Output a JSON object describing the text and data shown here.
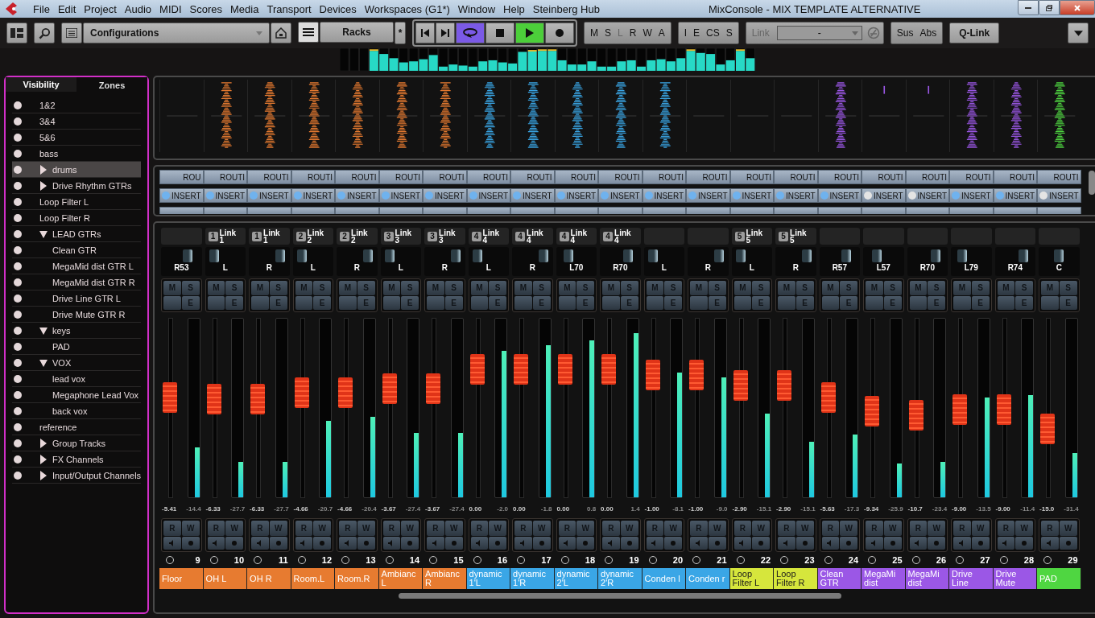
{
  "window": {
    "title": "MixConsole - MIX TEMPLATE ALTERNATIVE"
  },
  "menu": [
    "File",
    "Edit",
    "Project",
    "Audio",
    "MIDI",
    "Scores",
    "Media",
    "Transport",
    "Devices",
    "Workspaces (G1*)",
    "Window",
    "Help",
    "Steinberg Hub"
  ],
  "toolbar": {
    "configurations": "Configurations",
    "racks": "Racks",
    "racks_modified": "*",
    "transport": [
      {
        "kind": "prev",
        "on": false
      },
      {
        "kind": "next",
        "on": false
      },
      {
        "kind": "cycle",
        "on": true
      },
      {
        "kind": "stop",
        "on": false
      },
      {
        "kind": "play",
        "on": true
      },
      {
        "kind": "record",
        "on": false
      }
    ],
    "automation": [
      {
        "label": "M",
        "disabled": false
      },
      {
        "label": "S",
        "disabled": false
      },
      {
        "label": "L",
        "disabled": true
      },
      {
        "label": "R",
        "disabled": false
      },
      {
        "label": "W",
        "disabled": false
      },
      {
        "label": "A",
        "disabled": false
      }
    ],
    "states": [
      "I",
      "E",
      "CS",
      "S"
    ],
    "link": {
      "label": "Link",
      "value": "-"
    },
    "suspend": [
      "Sus",
      "Abs"
    ],
    "qlink": "Q-Link"
  },
  "sidebar": {
    "tabs": [
      {
        "label": "Visibility",
        "selected": true
      },
      {
        "label": "Zones",
        "selected": false
      }
    ],
    "items": [
      {
        "label": "1&2",
        "selected": false
      },
      {
        "label": "3&4",
        "selected": false
      },
      {
        "label": "5&6",
        "selected": false
      },
      {
        "label": "bass",
        "selected": false
      },
      {
        "label": "drums",
        "selected": true,
        "expanded": false
      },
      {
        "label": "Drive Rhythm GTRs",
        "selected": false,
        "expanded": false
      },
      {
        "label": "Loop Filter L",
        "selected": false
      },
      {
        "label": "Loop Filter R",
        "selected": false
      },
      {
        "label": "LEAD GTRs",
        "selected": false,
        "expanded": true,
        "children": [
          {
            "label": "Clean GTR",
            "selected": false
          },
          {
            "label": "MegaMid dist GTR L",
            "selected": false
          },
          {
            "label": "MegaMid dist GTR R",
            "selected": false
          },
          {
            "label": "Drive Line GTR L",
            "selected": false
          },
          {
            "label": "Drive Mute GTR R",
            "selected": false
          }
        ]
      },
      {
        "label": "keys",
        "selected": false,
        "expanded": true,
        "children": [
          {
            "label": "PAD",
            "selected": false
          }
        ]
      },
      {
        "label": "VOX",
        "selected": false,
        "expanded": true,
        "children": [
          {
            "label": "lead vox",
            "selected": false
          },
          {
            "label": "Megaphone Lead Vox",
            "selected": false
          },
          {
            "label": "back vox",
            "selected": false
          }
        ]
      },
      {
        "label": "reference",
        "selected": false
      },
      {
        "label": "Group Tracks",
        "selected": false,
        "expanded": false
      },
      {
        "label": "FX Channels",
        "selected": false,
        "expanded": false
      },
      {
        "label": "Input/Output Channels",
        "selected": false,
        "expanded": false
      }
    ]
  },
  "channels": [
    {
      "waveform": {
        "kind": "flat"
      },
      "routing": "ROU",
      "insert": "INSERT",
      "insert_on": true,
      "pan": {
        "label": "R53",
        "level": 0.77
      },
      "mute": "M",
      "solo": "S",
      "edit": "E",
      "fader": {
        "level": 0.57
      },
      "meter": {
        "level": 0.28
      },
      "volume": "-5.41",
      "peak": "-14.4",
      "read": "R",
      "write": "W",
      "number": "9",
      "name": "Floor",
      "color": "#e77b30"
    },
    {
      "waveform": {
        "kind": "full"
      },
      "routing": "ROUTI",
      "insert": "INSERT",
      "insert_on": true,
      "link": {
        "group": "1",
        "label": "Link",
        "sub": "1"
      },
      "pan": {
        "label": "L",
        "level": 0
      },
      "mute": "M",
      "solo": "S",
      "edit": "E",
      "fader": {
        "level": 0.56
      },
      "meter": {
        "level": 0.2
      },
      "volume": "-6.33",
      "peak": "-27.7",
      "read": "R",
      "write": "W",
      "number": "10",
      "name": "OH L",
      "color": "#e77b30"
    },
    {
      "waveform": {
        "kind": "full"
      },
      "routing": "ROUTI",
      "insert": "INSERT",
      "insert_on": true,
      "link": {
        "group": "1",
        "label": "Link",
        "sub": "1"
      },
      "pan": {
        "label": "R",
        "level": 1
      },
      "mute": "M",
      "solo": "S",
      "edit": "E",
      "fader": {
        "level": 0.56
      },
      "meter": {
        "level": 0.2
      },
      "volume": "-6.33",
      "peak": "-27.7",
      "read": "R",
      "write": "W",
      "number": "11",
      "name": "OH R",
      "color": "#e77b30"
    },
    {
      "waveform": {
        "kind": "full"
      },
      "routing": "ROUTI",
      "insert": "INSERT",
      "insert_on": true,
      "link": {
        "group": "2",
        "label": "Link",
        "sub": "2"
      },
      "pan": {
        "label": "L",
        "level": 0
      },
      "mute": "M",
      "solo": "S",
      "edit": "E",
      "fader": {
        "level": 0.6
      },
      "meter": {
        "level": 0.43
      },
      "volume": "-4.66",
      "peak": "-20.7",
      "read": "R",
      "write": "W",
      "number": "12",
      "name": "Room.L",
      "color": "#e77b30"
    },
    {
      "waveform": {
        "kind": "full"
      },
      "routing": "ROUTI",
      "insert": "INSERT",
      "insert_on": true,
      "link": {
        "group": "2",
        "label": "Link",
        "sub": "2"
      },
      "pan": {
        "label": "R",
        "level": 1
      },
      "mute": "M",
      "solo": "S",
      "edit": "E",
      "fader": {
        "level": 0.6
      },
      "meter": {
        "level": 0.45
      },
      "volume": "-4.66",
      "peak": "-20.4",
      "read": "R",
      "write": "W",
      "number": "13",
      "name": "Room.R",
      "color": "#e77b30"
    },
    {
      "waveform": {
        "kind": "full"
      },
      "routing": "ROUTI",
      "insert": "INSERT",
      "insert_on": true,
      "link": {
        "group": "3",
        "label": "Link",
        "sub": "3"
      },
      "pan": {
        "label": "L",
        "level": 0
      },
      "mute": "M",
      "solo": "S",
      "edit": "E",
      "fader": {
        "level": 0.63
      },
      "meter": {
        "level": 0.36
      },
      "volume": "-3.67",
      "peak": "-27.4",
      "read": "R",
      "write": "W",
      "number": "14",
      "name": "Ambianc L",
      "color": "#e77b30"
    },
    {
      "waveform": {
        "kind": "full"
      },
      "routing": "ROUTI",
      "insert": "INSERT",
      "insert_on": true,
      "link": {
        "group": "3",
        "label": "Link",
        "sub": "3"
      },
      "pan": {
        "label": "R",
        "level": 1
      },
      "mute": "M",
      "solo": "S",
      "edit": "E",
      "fader": {
        "level": 0.63
      },
      "meter": {
        "level": 0.36
      },
      "volume": "-3.67",
      "peak": "-27.4",
      "read": "R",
      "write": "W",
      "number": "15",
      "name": "Ambianc R",
      "color": "#e77b30"
    },
    {
      "waveform": {
        "kind": "full"
      },
      "routing": "ROUTI",
      "insert": "INSERT",
      "insert_on": true,
      "link": {
        "group": "4",
        "label": "Link",
        "sub": "4"
      },
      "pan": {
        "label": "L",
        "level": 0
      },
      "mute": "M",
      "solo": "S",
      "edit": "E",
      "fader": {
        "level": 0.76
      },
      "meter": {
        "level": 0.82
      },
      "volume": "0.00",
      "peak": "-2.0",
      "read": "R",
      "write": "W",
      "number": "16",
      "name": "dynamic 1'L",
      "color": "#3aa6e6"
    },
    {
      "waveform": {
        "kind": "full"
      },
      "routing": "ROUTI",
      "insert": "INSERT",
      "insert_on": true,
      "link": {
        "group": "4",
        "label": "Link",
        "sub": "4"
      },
      "pan": {
        "label": "R",
        "level": 1
      },
      "mute": "M",
      "solo": "S",
      "edit": "E",
      "fader": {
        "level": 0.76
      },
      "meter": {
        "level": 0.85
      },
      "volume": "0.00",
      "peak": "-1.8",
      "read": "R",
      "write": "W",
      "number": "17",
      "name": "dynamic 1'R",
      "color": "#3aa6e6"
    },
    {
      "waveform": {
        "kind": "full"
      },
      "routing": "ROUTI",
      "insert": "INSERT",
      "insert_on": true,
      "link": {
        "group": "4",
        "label": "Link",
        "sub": "4"
      },
      "pan": {
        "label": "L70",
        "level": 0.15
      },
      "mute": "M",
      "solo": "S",
      "edit": "E",
      "fader": {
        "level": 0.76
      },
      "meter": {
        "level": 0.88
      },
      "volume": "0.00",
      "peak": "0.8",
      "read": "R",
      "write": "W",
      "number": "18",
      "name": "dynamic 2'L",
      "color": "#3aa6e6"
    },
    {
      "waveform": {
        "kind": "full"
      },
      "routing": "ROUTI",
      "insert": "INSERT",
      "insert_on": true,
      "link": {
        "group": "4",
        "label": "Link",
        "sub": "4"
      },
      "pan": {
        "label": "R70",
        "level": 0.85
      },
      "mute": "M",
      "solo": "S",
      "edit": "E",
      "fader": {
        "level": 0.76
      },
      "meter": {
        "level": 0.92
      },
      "volume": "0.00",
      "peak": "1.4",
      "read": "R",
      "write": "W",
      "number": "19",
      "name": "dynamic 2'R",
      "color": "#3aa6e6"
    },
    {
      "waveform": {
        "kind": "full"
      },
      "routing": "ROUTI",
      "insert": "INSERT",
      "insert_on": true,
      "pan": {
        "label": "L",
        "level": 0
      },
      "mute": "M",
      "solo": "S",
      "edit": "E",
      "fader": {
        "level": 0.72
      },
      "meter": {
        "level": 0.7
      },
      "volume": "-1.00",
      "peak": "-8.1",
      "read": "R",
      "write": "W",
      "number": "20",
      "name": "Conden l",
      "color": "#3aa6e6"
    },
    {
      "waveform": {
        "kind": "flat"
      },
      "routing": "ROUTI",
      "insert": "INSERT",
      "insert_on": true,
      "pan": {
        "label": "R",
        "level": 1
      },
      "mute": "M",
      "solo": "S",
      "edit": "E",
      "fader": {
        "level": 0.72
      },
      "meter": {
        "level": 0.67
      },
      "volume": "-1.00",
      "peak": "-9.0",
      "read": "R",
      "write": "W",
      "number": "21",
      "name": "Conden r",
      "color": "#3aa6e6"
    },
    {
      "waveform": {
        "kind": "flat"
      },
      "routing": "ROUTI",
      "insert": "INSERT",
      "insert_on": true,
      "link": {
        "group": "5",
        "label": "Link",
        "sub": "5"
      },
      "pan": {
        "label": "L",
        "level": 0
      },
      "mute": "M",
      "solo": "S",
      "edit": "E",
      "fader": {
        "level": 0.65
      },
      "meter": {
        "level": 0.47
      },
      "volume": "-2.90",
      "peak": "-15.1",
      "read": "R",
      "write": "W",
      "number": "22",
      "name": "Loop Filter L",
      "color": "#d6e63c"
    },
    {
      "waveform": {
        "kind": "flat"
      },
      "routing": "ROUTI",
      "insert": "INSERT",
      "insert_on": true,
      "link": {
        "group": "5",
        "label": "Link",
        "sub": "5"
      },
      "pan": {
        "label": "R",
        "level": 1
      },
      "mute": "M",
      "solo": "S",
      "edit": "E",
      "fader": {
        "level": 0.65
      },
      "meter": {
        "level": 0.31
      },
      "volume": "-2.90",
      "peak": "-15.1",
      "read": "R",
      "write": "W",
      "number": "23",
      "name": "Loop Filter R",
      "color": "#d6e63c"
    },
    {
      "waveform": {
        "kind": "full"
      },
      "routing": "ROUTI",
      "insert": "INSERT",
      "insert_on": true,
      "pan": {
        "label": "R57",
        "level": 0.78
      },
      "mute": "M",
      "solo": "S",
      "edit": "E",
      "fader": {
        "level": 0.57
      },
      "meter": {
        "level": 0.35
      },
      "volume": "-5.63",
      "peak": "-17.3",
      "read": "R",
      "write": "W",
      "number": "24",
      "name": "Clean GTR",
      "color": "#9b57e6"
    },
    {
      "waveform": {
        "kind": "blip"
      },
      "routing": "ROUTI",
      "insert": "INSERT",
      "insert_on": false,
      "pan": {
        "label": "L57",
        "level": 0.21
      },
      "mute": "M",
      "solo": "S",
      "edit": "E",
      "fader": {
        "level": 0.48
      },
      "meter": {
        "level": 0.19
      },
      "volume": "-9.34",
      "peak": "-25.9",
      "read": "R",
      "write": "W",
      "number": "25",
      "name": "MegaMi dist",
      "color": "#9b57e6"
    },
    {
      "waveform": {
        "kind": "blip"
      },
      "routing": "ROUTI",
      "insert": "INSERT",
      "insert_on": false,
      "pan": {
        "label": "R70",
        "level": 0.85
      },
      "mute": "M",
      "solo": "S",
      "edit": "E",
      "fader": {
        "level": 0.45
      },
      "meter": {
        "level": 0.2
      },
      "volume": "-10.7",
      "peak": "-23.4",
      "read": "R",
      "write": "W",
      "number": "26",
      "name": "MegaMi dist",
      "color": "#9b57e6"
    },
    {
      "waveform": {
        "kind": "full"
      },
      "routing": "ROUTI",
      "insert": "INSERT",
      "insert_on": true,
      "pan": {
        "label": "L79",
        "level": 0.1
      },
      "mute": "M",
      "solo": "S",
      "edit": "E",
      "fader": {
        "level": 0.49
      },
      "meter": {
        "level": 0.56
      },
      "volume": "-9.00",
      "peak": "-13.5",
      "read": "R",
      "write": "W",
      "number": "27",
      "name": "Drive Line",
      "color": "#9b57e6"
    },
    {
      "waveform": {
        "kind": "full"
      },
      "routing": "ROUTI",
      "insert": "INSERT",
      "insert_on": true,
      "pan": {
        "label": "R74",
        "level": 0.87
      },
      "mute": "M",
      "solo": "S",
      "edit": "E",
      "fader": {
        "level": 0.49
      },
      "meter": {
        "level": 0.57
      },
      "volume": "-9.00",
      "peak": "-11.4",
      "read": "R",
      "write": "W",
      "number": "28",
      "name": "Drive Mute",
      "color": "#9b57e6"
    },
    {
      "waveform": {
        "kind": "full"
      },
      "routing": "ROUTI",
      "insert": "INSERT",
      "insert_on": false,
      "pan": {
        "label": "C",
        "level": 0.5
      },
      "mute": "M",
      "solo": "S",
      "edit": "E",
      "fader": {
        "level": 0.36
      },
      "meter": {
        "level": 0.25
      },
      "volume": "-15.0",
      "peak": "-31.4",
      "read": "R",
      "write": "W",
      "number": "29",
      "name": "PAD",
      "color": "#4fd641"
    }
  ]
}
